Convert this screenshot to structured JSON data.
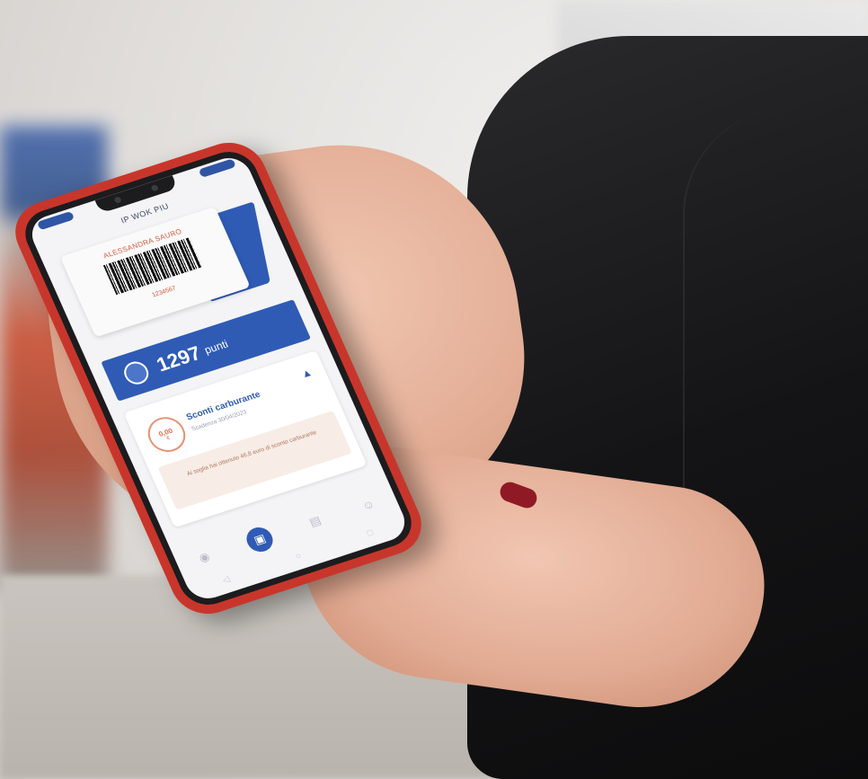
{
  "app": {
    "title": "IP WOK PIU"
  },
  "card": {
    "holder_name": "ALESSANDRA SAURO",
    "code": "1234567"
  },
  "points": {
    "value": "1297",
    "unit": "punti"
  },
  "discount": {
    "badge_value": "0,00",
    "badge_currency": "€",
    "title": "Sconti carburante",
    "date": "Scadenza 30/04/2023",
    "note": "Ai soglia hai ottenuto 46,8 euro di sconto carburante",
    "expand_icon": "chevron-up-icon"
  },
  "tabbar": {
    "icons": [
      "location-icon",
      "card-icon",
      "receipt-icon",
      "profile-icon"
    ]
  },
  "colors": {
    "brand_blue": "#2f5bb5",
    "accent_orange": "#e07050",
    "phone_case": "#c8362b"
  }
}
